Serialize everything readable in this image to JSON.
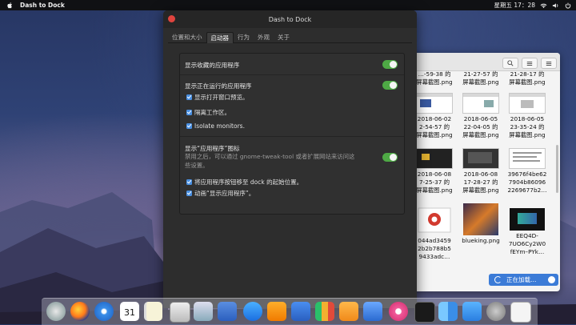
{
  "menubar": {
    "app_name": "Dash to Dock",
    "clock": "星期五 17：28"
  },
  "dialog": {
    "title": "Dash to Dock",
    "tabs": [
      "位置和大小",
      "启动器",
      "行为",
      "外观",
      "关于"
    ],
    "active_tab": "启动器",
    "settings": {
      "show_favorites": {
        "label": "显示收藏的应用程序",
        "enabled": true
      },
      "show_running": {
        "label": "显示正在运行的应用程序",
        "enabled": true
      },
      "show_window_previews": {
        "label": "显示打开窗口预览。",
        "checked": true
      },
      "isolate_workspaces": {
        "label": "隔离工作区。",
        "checked": true
      },
      "isolate_monitors": {
        "label": "Isolate monitors.",
        "checked": true
      },
      "show_apps_icon": {
        "label": "显示“应用程序”图标",
        "enabled": true
      },
      "show_apps_desc_line1": "禁用之后，可以通过 gnome-tweak-tool 或者扩展网站来访问这",
      "show_apps_desc_line2": "些设置。",
      "move_to_start": {
        "label": "将应用程序按钮移至 dock 的起始位置。",
        "checked": true
      },
      "animate": {
        "label": "动画“显示应用程序”。",
        "checked": true
      }
    }
  },
  "finder": {
    "files": [
      {
        "line1": "…-59-38 的",
        "line2": "屏幕截图.png"
      },
      {
        "line1": "21-27-57 的",
        "line2": "屏幕截图.png"
      },
      {
        "line1": "21-28-17 的",
        "line2": "屏幕截图.png"
      },
      {
        "line1": "2018-06-02",
        "line2": "2-54-57 的",
        "line3": "屏幕截图.png"
      },
      {
        "line1": "2018-06-05",
        "line2": "22-04-05 的",
        "line3": "屏幕截图.png"
      },
      {
        "line1": "2018-06-05",
        "line2": "23-35-24 的",
        "line3": "屏幕截图.png"
      },
      {
        "line1": "2018-06-08",
        "line2": "7-25-37 的",
        "line3": "屏幕截图.png"
      },
      {
        "line1": "2018-06-08",
        "line2": "17-28-27 的",
        "line3": "屏幕截图.png"
      },
      {
        "line1": "39676f4be62",
        "line2": "7904b86096",
        "line3": "2269677b2…"
      },
      {
        "line1": "044ad3459",
        "line2": "2b2b788b5",
        "line3": "9433adc…"
      },
      {
        "line1": "blueking.png",
        "line2": "",
        "line3": ""
      },
      {
        "line1": "EEQ4D-",
        "line2": "7UO6Cy2W0",
        "line3": "fEYm–PYk…"
      }
    ],
    "loading_text": "正在加载…"
  },
  "dock": {
    "icons": [
      "rocket-icon",
      "firefox-icon",
      "safari-icon",
      "calendar-icon",
      "notes-icon",
      "photos-icon",
      "preview-icon",
      "image-capture-icon",
      "app-store-icon",
      "ibooks-icon",
      "keynote-icon",
      "numbers-icon",
      "pages-icon",
      "keynote-stand-icon",
      "itunes-icon",
      "terminal-icon",
      "finder-icon",
      "mail-icon",
      "system-prefs-icon",
      "text-edit-icon"
    ],
    "calendar_day": "31"
  }
}
